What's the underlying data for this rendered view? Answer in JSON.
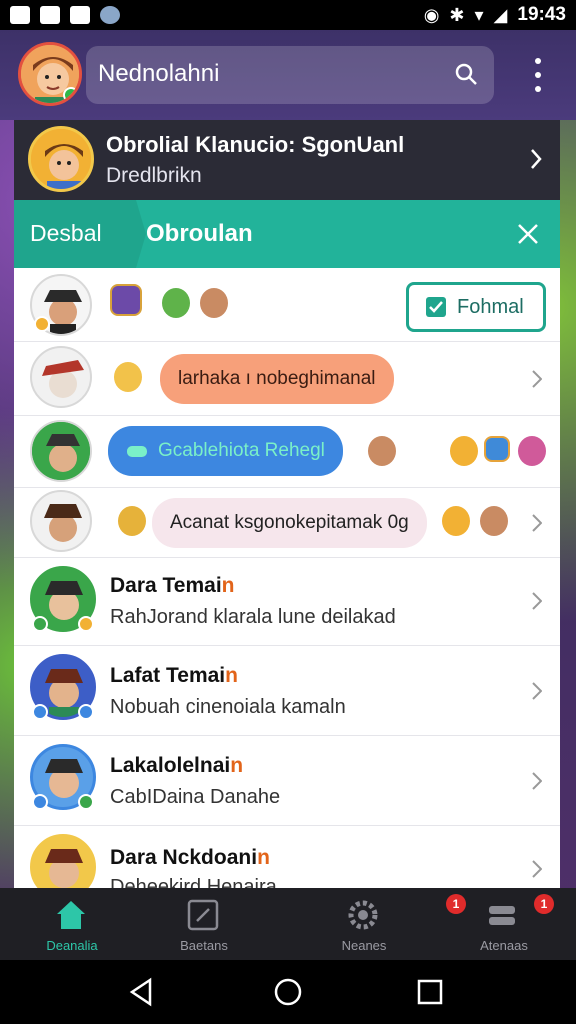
{
  "statusbar": {
    "time": "19:43"
  },
  "header": {
    "title": "Nednolahni"
  },
  "pinned": {
    "title": "Obrolial Klanucio: SgonUanl",
    "subtitle": "Dredlbrikn"
  },
  "tabs": {
    "tab_a": "Desbal",
    "tab_b": "Obroulan"
  },
  "rows": {
    "r1_button": "Fohmal",
    "r2_chip": "larhaka ı nobeghimanal",
    "r3_chip": "Gcablehiota Rehegl",
    "r4_chip": "Acanat ksgonokepitamak 0g",
    "r5_name": "Dara Temai",
    "r5_name_acc": "n",
    "r5_sub": "RahJorand klarala lune deilakad",
    "r6_name": "Lafat Temai",
    "r6_name_acc": "n",
    "r6_sub": "Nobuah cinenoiala kamaln",
    "r7_name": "Lakalolelnai",
    "r7_name_acc": "n",
    "r7_sub": "CabIDaina Danahe",
    "r8_name": "Dara Nckdoani",
    "r8_name_acc": "n",
    "r8_sub": "Deheekird Henaira"
  },
  "bottom_nav": [
    {
      "label": "Deanalia",
      "icon": "home-icon",
      "active": true
    },
    {
      "label": "Baetans",
      "icon": "edit-icon",
      "active": false
    },
    {
      "label": "Neanes",
      "icon": "gear-icon",
      "active": false
    },
    {
      "label": "Atenaas",
      "icon": "chat-icon",
      "active": false
    }
  ],
  "badges": {
    "neanes": "1",
    "atenaas": "1"
  },
  "colors": {
    "accent": "#22b39a",
    "orange": "#e2641a",
    "notif": "#e02b2b"
  }
}
